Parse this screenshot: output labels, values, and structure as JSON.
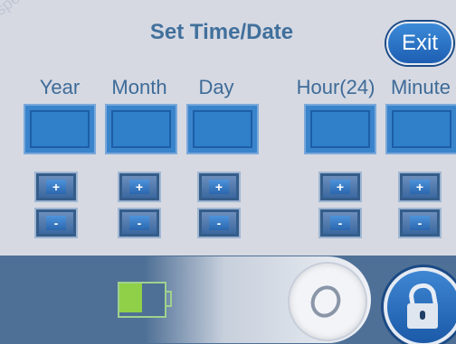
{
  "title": "Set Time/Date",
  "exit_label": "Exit",
  "watermark": "spe",
  "fields": [
    {
      "label": "Year"
    },
    {
      "label": "Month"
    },
    {
      "label": "Day"
    },
    {
      "label": "Hour(24)"
    },
    {
      "label": "Minute"
    }
  ],
  "plus_label": "+",
  "minus_label": "-",
  "battery_level": 0.55,
  "colors": {
    "background": "#d6d9e2",
    "title": "#41709c",
    "field": "#2f7fc9",
    "bottom_bar": "#4f7096",
    "battery": "#8fd048"
  }
}
